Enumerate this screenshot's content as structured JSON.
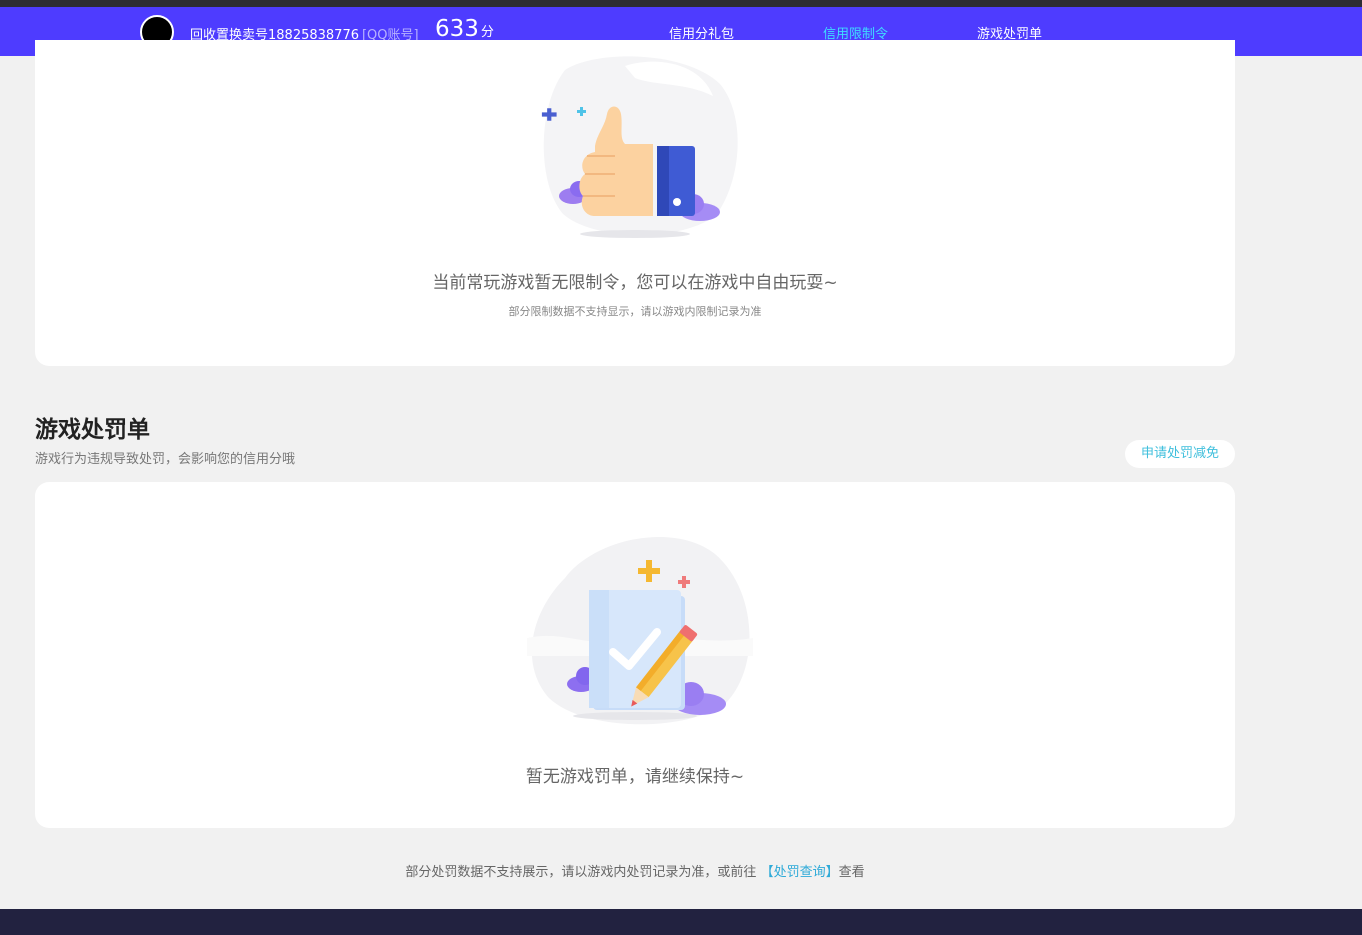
{
  "header": {
    "account_name": "回收置换卖号18825838776",
    "account_type": "[QQ账号]",
    "score": "633",
    "score_unit": "分",
    "tabs": [
      {
        "label": "信用分礼包",
        "active": false
      },
      {
        "label": "信用限制令",
        "active": true
      },
      {
        "label": "游戏处罚单",
        "active": false
      }
    ]
  },
  "restriction": {
    "empty_title": "当前常玩游戏暂无限制令，您可以在游戏中自由玩耍~",
    "empty_note": "部分限制数据不支持显示，请以游戏内限制记录为准"
  },
  "penalty": {
    "title": "游戏处罚单",
    "description": "游戏行为违规导致处罚，会影响您的信用分哦",
    "appeal_button": "申请处罚减免",
    "empty_title": "暂无游戏罚单，请继续保持~"
  },
  "footer": {
    "note_prefix": "部分处罚数据不支持展示，请以游戏内处罚记录为准，或前往",
    "link_label": "【处罚查询】",
    "note_suffix": "查看"
  },
  "colors": {
    "navbar": "#4e3cff",
    "active_tab": "#3fdcff",
    "link": "#2eaad8",
    "page_bg": "#f1f1f1"
  }
}
